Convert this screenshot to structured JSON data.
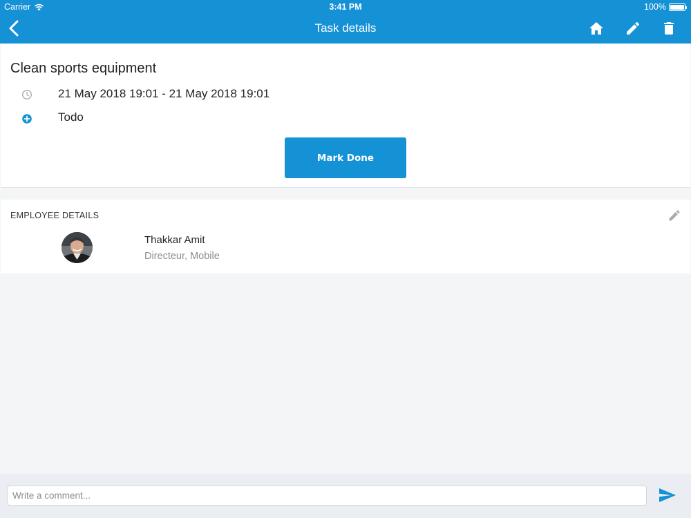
{
  "status_bar": {
    "carrier": "Carrier",
    "time": "3:41 PM",
    "battery": "100%",
    "battery_level": 1.0
  },
  "nav": {
    "title": "Task details",
    "icons": [
      "back-chevron-icon",
      "home-icon",
      "pencil-icon",
      "trash-icon"
    ]
  },
  "task": {
    "title": "Clean sports equipment",
    "date_range": "21 May 2018 19:01 - 21 May 2018 19:01",
    "status": "Todo",
    "mark_done_label": "Mark Done"
  },
  "employee_details": {
    "section_title": "EMPLOYEE DETAILS",
    "name": "Thakkar Amit",
    "role": "Directeur, Mobile"
  },
  "comment": {
    "placeholder": "Write a comment...",
    "value": ""
  },
  "colors": {
    "accent": "#1591d6",
    "background": "#f4f5f6",
    "card": "#ffffff",
    "muted_text": "#8a8d91",
    "bottom_bar": "#eaeef2"
  }
}
